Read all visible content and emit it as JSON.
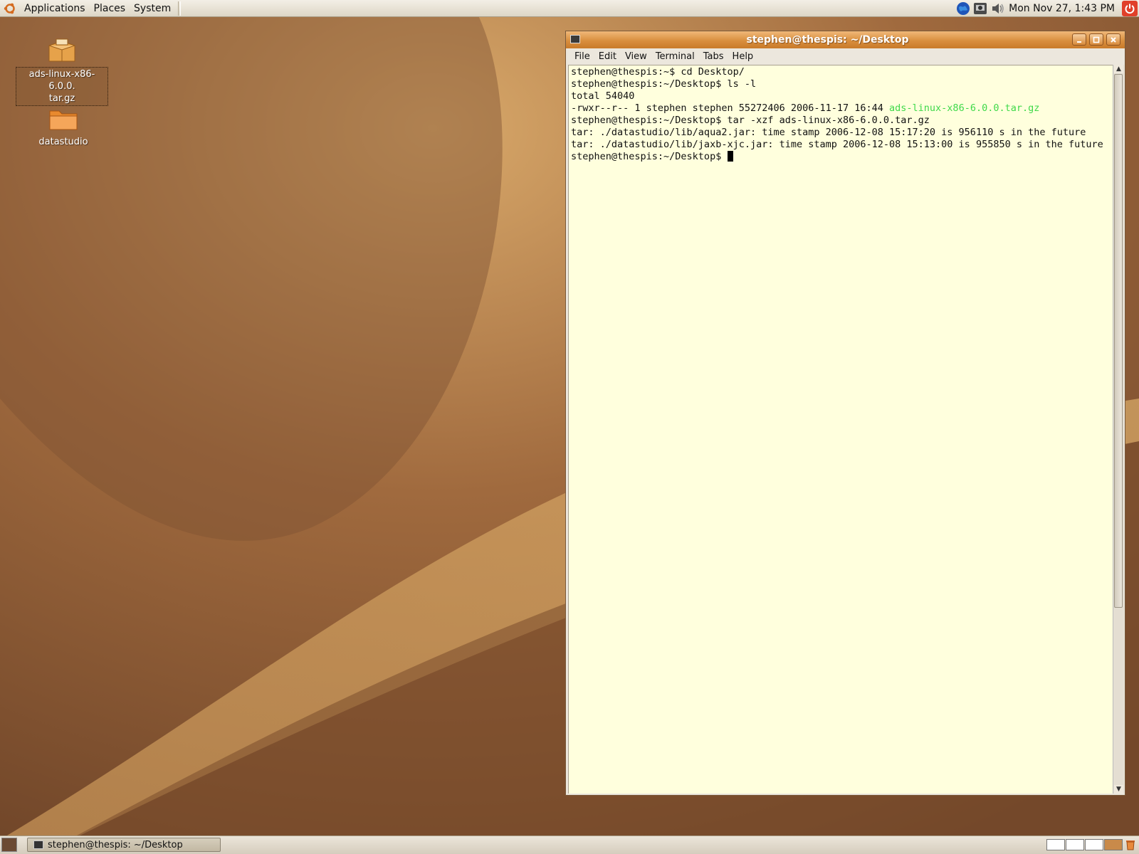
{
  "top_panel": {
    "menus": [
      "Applications",
      "Places",
      "System"
    ],
    "clock": "Mon Nov 27,  1:43 PM",
    "tray_icons": [
      "globe-icon",
      "network-monitor-icon",
      "volume-icon"
    ],
    "quit_icon": "power-icon"
  },
  "desktop_icons": [
    {
      "label": "ads-linux-x86-6.0.0.\ntar.gz",
      "icon": "archive-icon",
      "selected": true
    },
    {
      "label": "datastudio",
      "icon": "folder-icon",
      "selected": false
    }
  ],
  "terminal": {
    "title": "stephen@thespis: ~/Desktop",
    "menus": [
      "File",
      "Edit",
      "View",
      "Terminal",
      "Tabs",
      "Help"
    ],
    "lines": [
      "stephen@thespis:~$ cd Desktop/",
      "stephen@thespis:~/Desktop$ ls -l",
      "total 54040",
      "-rwxr--r-- 1 stephen stephen 55272406 2006-11-17 16:44 ",
      "stephen@thespis:~/Desktop$ tar -xzf ads-linux-x86-6.0.0.tar.gz",
      "tar: ./datastudio/lib/aqua2.jar: time stamp 2006-12-08 15:17:20 is 956110 s in the future",
      "tar: ./datastudio/lib/jaxb-xjc.jar: time stamp 2006-12-08 15:13:00 is 955850 s in the future",
      "stephen@thespis:~/Desktop$ "
    ],
    "highlighted_file": "ads-linux-x86-6.0.0.tar.gz",
    "highlight_color": "#3fd94a",
    "background_color": "#ffffdd"
  },
  "bottom_panel": {
    "task_label": "stephen@thespis: ~/Desktop",
    "workspace_count": 4,
    "active_workspace": 4
  },
  "colors": {
    "accent": "#d98f3e",
    "wallpaper": "#8a5a35"
  }
}
